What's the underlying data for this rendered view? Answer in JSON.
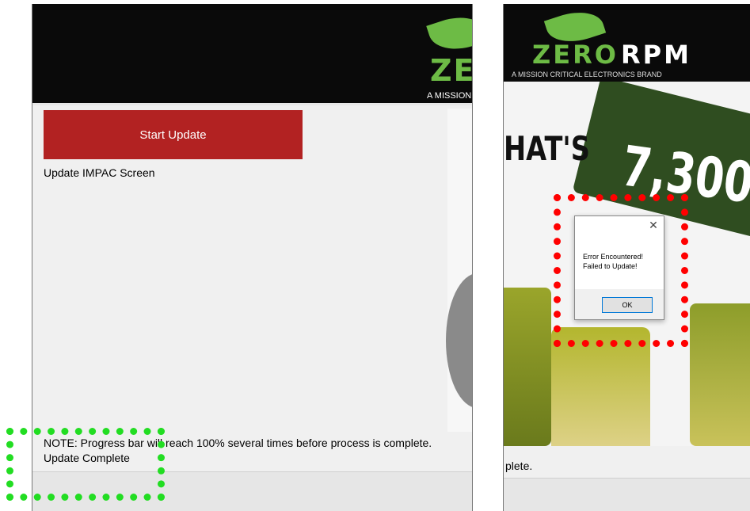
{
  "left_window": {
    "logo_text": "ZERORPM",
    "logo_tagline": "A MISSION CRITICAL ELECTRONICS BRAND",
    "start_button": "Start Update",
    "section_label": "Update IMPAC Screen",
    "note": "NOTE: Progress bar will reach 100% several times before process is complete.",
    "status": "Update Complete"
  },
  "right_window": {
    "logo_zero": "ZERO",
    "logo_rpm": "RPM",
    "logo_tagline": "A MISSION CRITICAL ELECTRONICS BRAND",
    "banner_word": "HAT'S",
    "banner_number": "7,300",
    "status_fragment": "plete."
  },
  "dialog": {
    "close_glyph": "✕",
    "message_line1": "Error Encountered!",
    "message_line2": "Failed to Update!",
    "ok_label": "OK"
  },
  "colors": {
    "brand_green": "#6dbb45",
    "button_red": "#b22222",
    "annotation_red": "#ff0000",
    "annotation_green": "#22dd22"
  }
}
